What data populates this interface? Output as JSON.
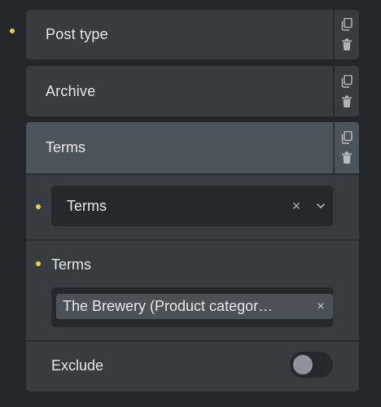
{
  "conditions": [
    {
      "label": "Post type"
    },
    {
      "label": "Archive"
    },
    {
      "label": "Terms"
    }
  ],
  "terms_panel": {
    "select": {
      "value": "Terms",
      "clear_glyph": "×"
    },
    "terms_label": "Terms",
    "selected_tag": {
      "text": "The Brewery (Product categor…",
      "remove_glyph": "×"
    },
    "exclude_label": "Exclude",
    "exclude_on": false
  },
  "colors": {
    "indicator_dot": "#f2cf3a",
    "item_bg": "#383c42",
    "active_header_bg": "#4b535b"
  },
  "icons": {
    "copy": "copy-icon",
    "delete": "trash-icon",
    "dropdown": "chevron-down-icon"
  }
}
